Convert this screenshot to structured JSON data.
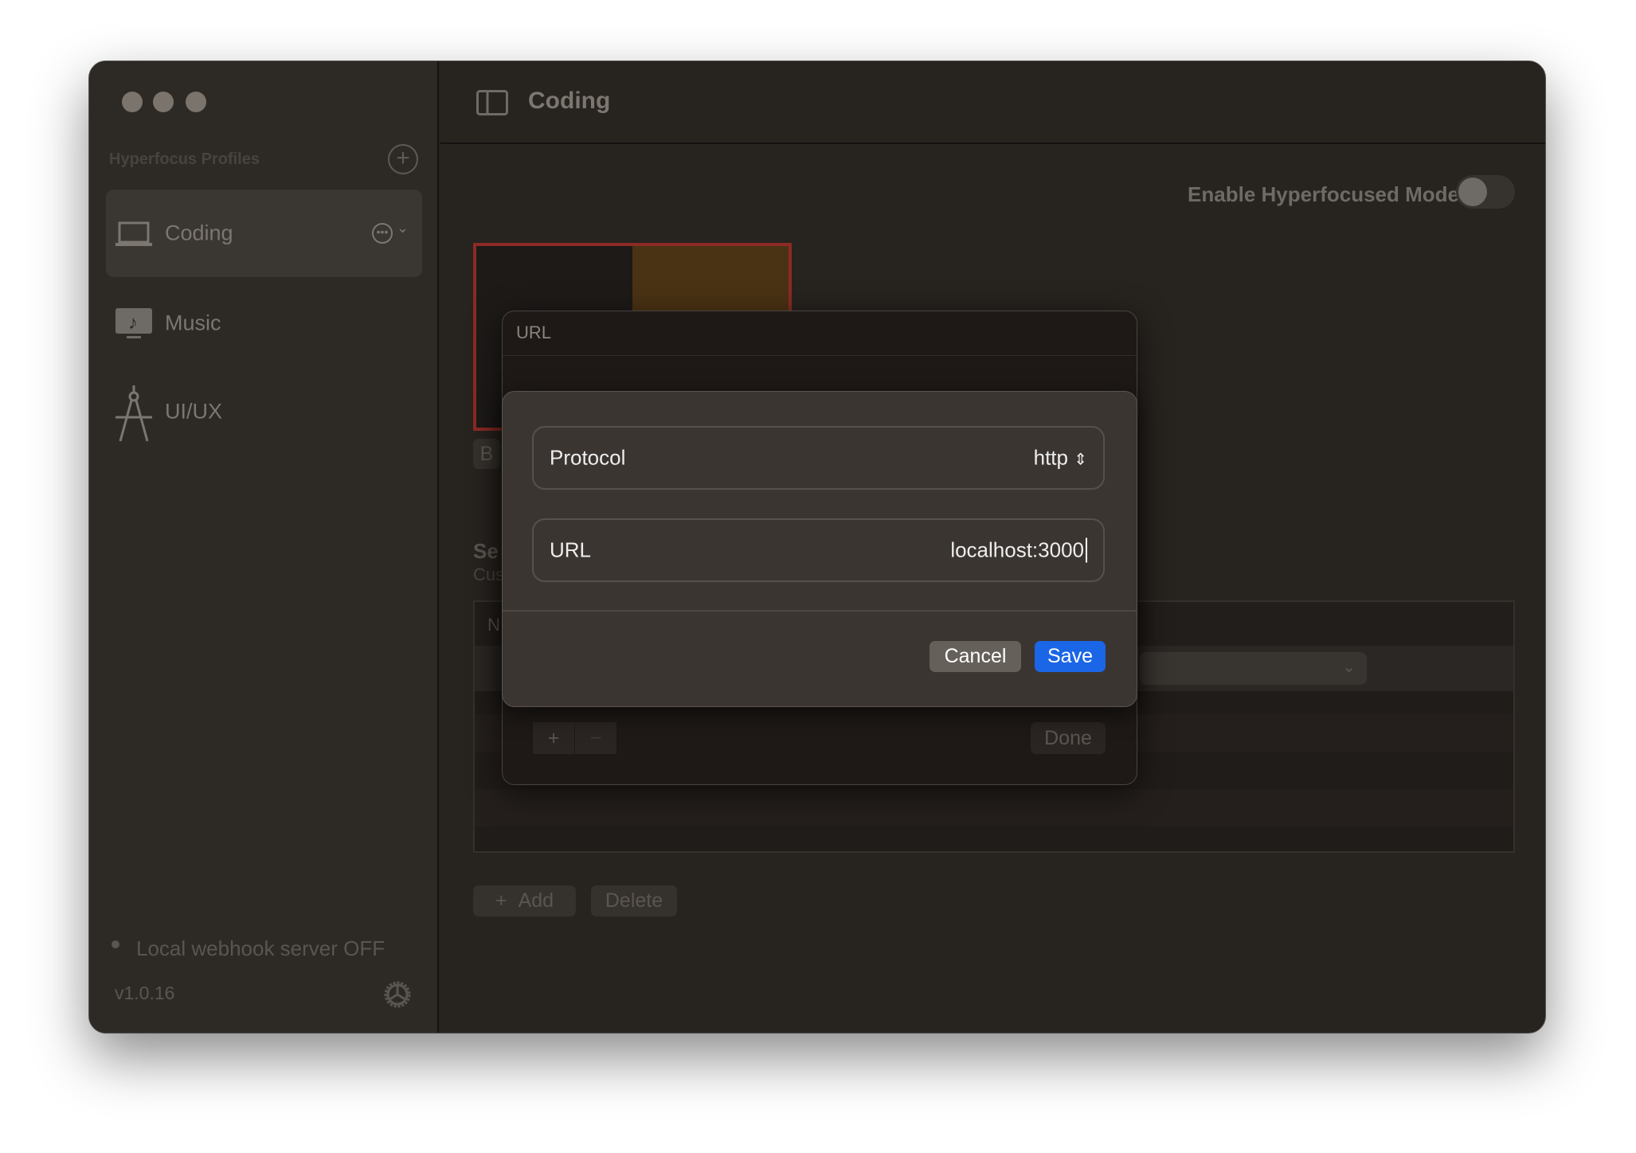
{
  "sidebar": {
    "section_title": "Hyperfocus Profiles",
    "items": [
      {
        "label": "Coding",
        "icon": "laptop-icon"
      },
      {
        "label": "Music",
        "icon": "music-icon"
      },
      {
        "label": "UI/UX",
        "icon": "compass-icon"
      }
    ],
    "status": "Local webhook server OFF",
    "version": "v1.0.16"
  },
  "header": {
    "title": "Coding"
  },
  "main": {
    "toggle_label": "Enable Hyperfocused Mode",
    "toggle_on": false,
    "partial_button": "B",
    "section_partial": "Se",
    "section_sub_partial": "Cus",
    "table_header_partial": "N",
    "add_label": "Add",
    "delete_label": "Delete"
  },
  "dialog": {
    "title": "URL",
    "done_label": "Done",
    "add": "+",
    "remove": "−",
    "sheet": {
      "protocol_label": "Protocol",
      "protocol_value": "http",
      "url_label": "URL",
      "url_value": "localhost:3000",
      "cancel": "Cancel",
      "save": "Save"
    }
  },
  "colors": {
    "accent": "#1a66e6",
    "thumb_border": "#8c2a25"
  }
}
